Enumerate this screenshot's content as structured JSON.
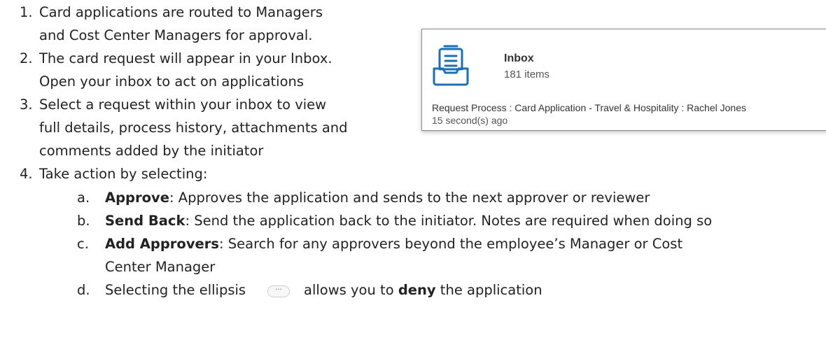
{
  "steps": [
    {
      "num": "1.",
      "lines": [
        "Card applications are routed to Managers",
        "and Cost Center Managers for approval."
      ]
    },
    {
      "num": "2.",
      "lines": [
        "The card request will appear in your Inbox.",
        "Open your inbox to act on applications"
      ]
    },
    {
      "num": "3.",
      "lines": [
        "Select a request within your inbox to view",
        "full details, process history, attachments and",
        "comments added by the initiator"
      ]
    },
    {
      "num": "4.",
      "lines": [
        "Take action by selecting:"
      ]
    }
  ],
  "actions": [
    {
      "letter": "a.",
      "term": "Approve",
      "desc": ": Approves the application and sends to the next approver or reviewer"
    },
    {
      "letter": "b.",
      "term": "Send Back",
      "desc": ": Send the application back to the initiator. Notes are required when doing so"
    },
    {
      "letter": "c.",
      "term": "Add Approvers",
      "desc": ": Search for any approvers beyond the employee’s Manager or Cost",
      "desc2": "Center Manager"
    },
    {
      "letter": "d.",
      "before": "Selecting the ellipsis",
      "after": "allows you to ",
      "bold": "deny",
      "end": " the application",
      "button_glyph": "···"
    }
  ],
  "inbox": {
    "title": "Inbox",
    "count": "181 items",
    "request": "Request Process : Card Application - Travel & Hospitality : Rachel Jones",
    "time": "15 second(s) ago",
    "icon": "inbox-tray-icon",
    "icon_color": "#1a6fb5"
  }
}
